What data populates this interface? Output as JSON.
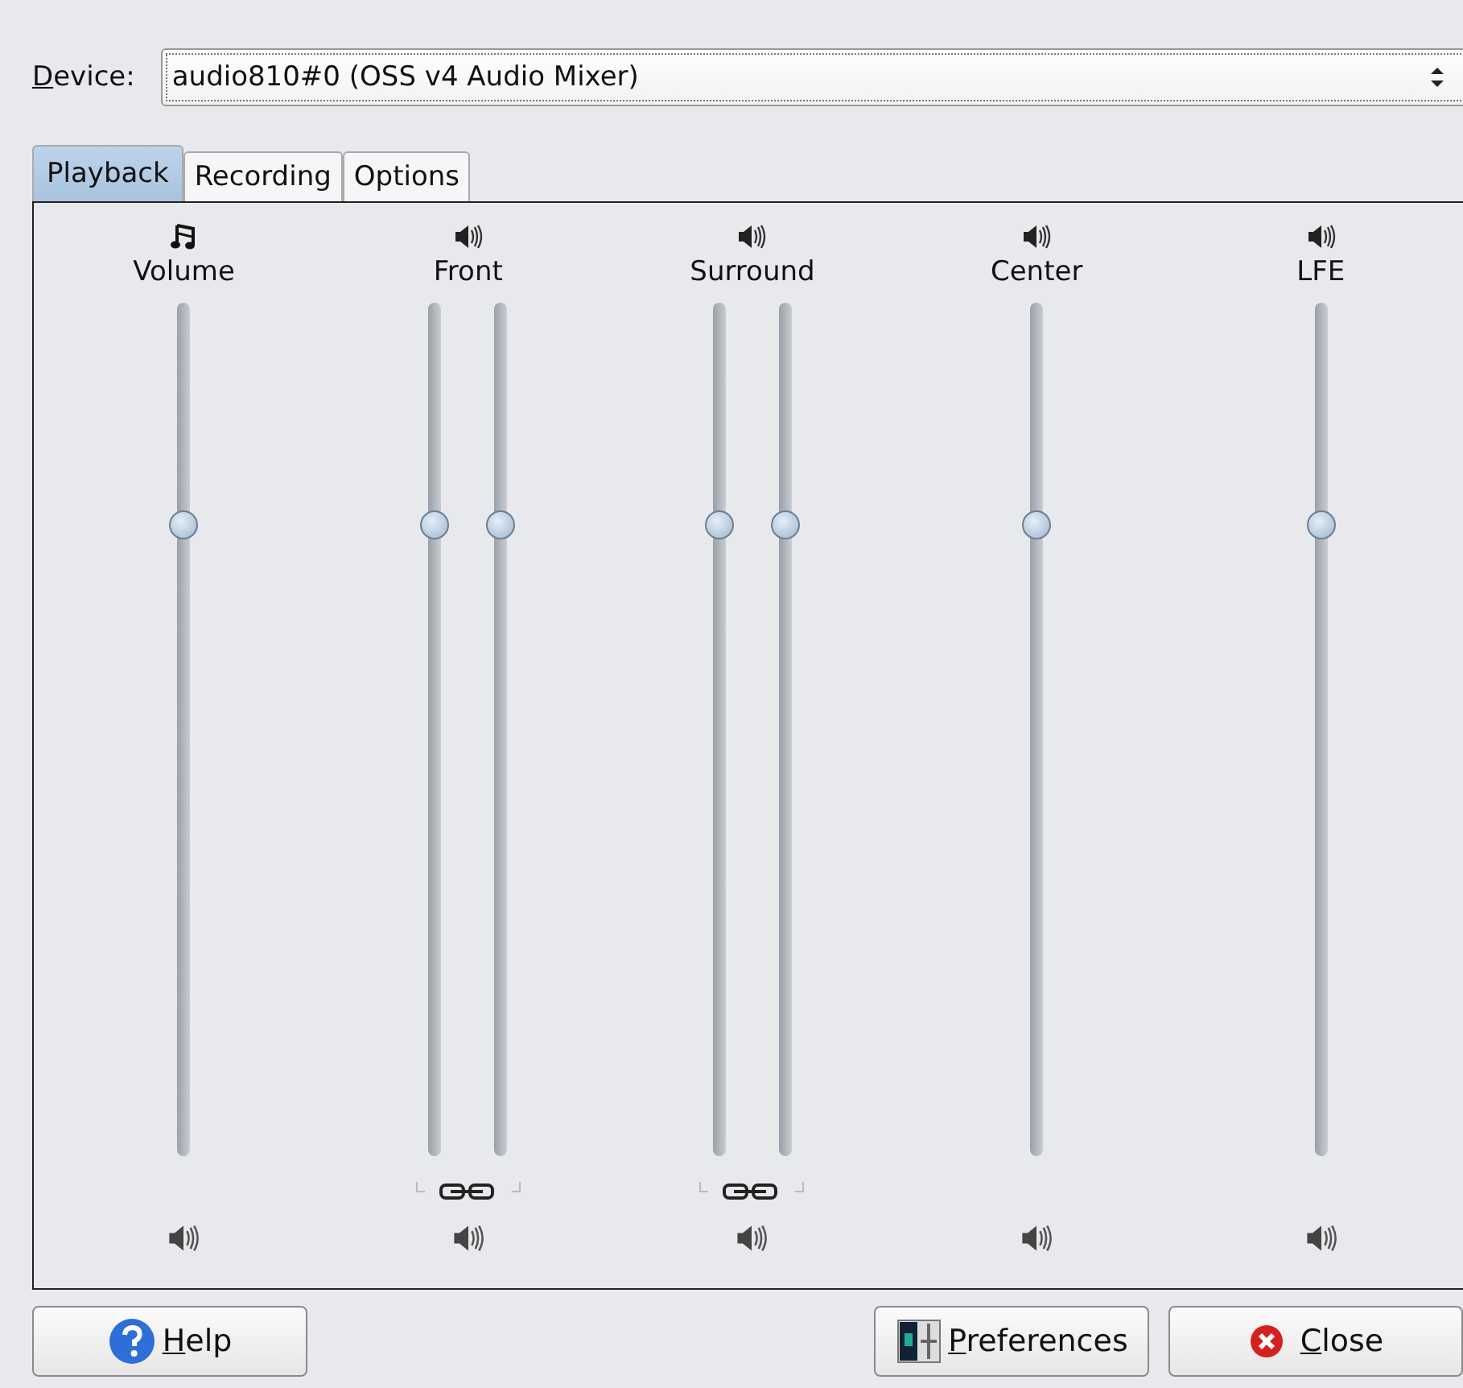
{
  "device": {
    "label": "Device:",
    "value": "audio810#0 (OSS v4 Audio Mixer)"
  },
  "tabs": [
    {
      "label": "Playback",
      "selected": true
    },
    {
      "label": "Recording",
      "selected": false
    },
    {
      "label": "Options",
      "selected": false
    }
  ],
  "channels": [
    {
      "name": "Volume",
      "kind": "note",
      "linked": false,
      "sliders": [
        {
          "level": 0.74
        }
      ]
    },
    {
      "name": "Front",
      "kind": "speaker",
      "linked": true,
      "sliders": [
        {
          "level": 0.74
        },
        {
          "level": 0.74
        }
      ]
    },
    {
      "name": "Surround",
      "kind": "speaker",
      "linked": true,
      "sliders": [
        {
          "level": 0.74
        },
        {
          "level": 0.74
        }
      ]
    },
    {
      "name": "Center",
      "kind": "speaker",
      "linked": false,
      "sliders": [
        {
          "level": 0.74
        }
      ]
    },
    {
      "name": "LFE",
      "kind": "speaker",
      "linked": false,
      "sliders": [
        {
          "level": 0.74
        }
      ]
    }
  ],
  "buttons": [
    {
      "kind": "help",
      "label": "Help"
    },
    {
      "kind": "preferences",
      "label": "Preferences"
    },
    {
      "kind": "close",
      "label": "Close"
    }
  ]
}
